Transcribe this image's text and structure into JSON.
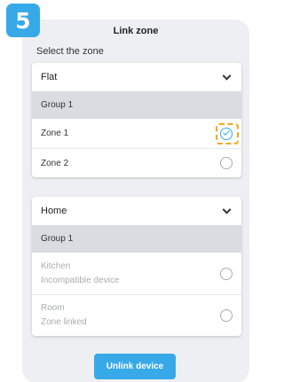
{
  "step_badge": "5",
  "title": "Link zone",
  "section_label": "Select the zone",
  "cards": [
    {
      "header": "Flat",
      "group": "Group 1",
      "zones": [
        {
          "name": "Zone 1",
          "selected": true
        },
        {
          "name": "Zone 2",
          "selected": false
        }
      ]
    },
    {
      "header": "Home",
      "group": "Group 1",
      "zones": [
        {
          "name": "Kitchen",
          "status": "Incompatible device",
          "selected": false
        },
        {
          "name": "Room",
          "status": "Zone linked",
          "selected": false
        }
      ]
    }
  ],
  "unlink_button": "Unlink device",
  "colors": {
    "accent": "#37a9e8",
    "highlight": "#f5a623",
    "panel_bg": "#edeff2",
    "group_bg": "#d9dce1"
  }
}
